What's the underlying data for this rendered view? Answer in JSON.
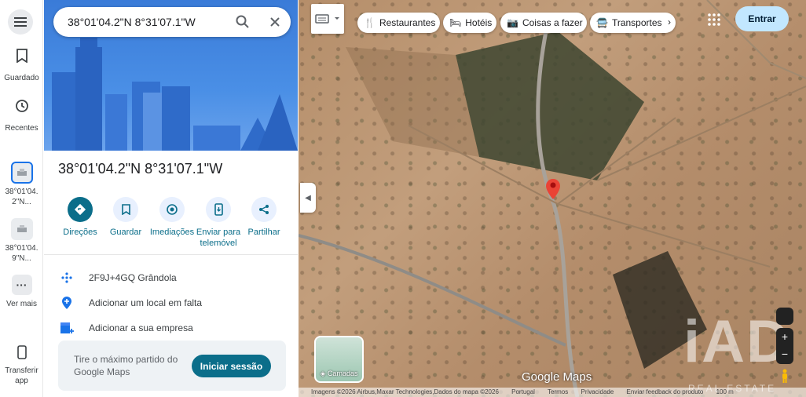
{
  "rail": {
    "saved_label": "Guardado",
    "recent_label": "Recentes",
    "history1_label": "38°01'04. 2\"N...",
    "history2_label": "38°01'04. 9\"N...",
    "more_label": "Ver mais",
    "transfer_label": "Transferir app"
  },
  "search": {
    "value": "38°01'04.2\"N 8°31'07.1\"W"
  },
  "place": {
    "title": "38°01'04.2\"N 8°31'07.1\"W"
  },
  "actions": [
    {
      "label": "Direções"
    },
    {
      "label": "Guardar"
    },
    {
      "label": "Imediações"
    },
    {
      "label": "Enviar para telemóvel"
    },
    {
      "label": "Partilhar"
    }
  ],
  "info": {
    "plus_code": "2F9J+4GQ Grândola",
    "add_place": "Adicionar um local em falta",
    "add_business": "Adicionar a sua empresa"
  },
  "promo": {
    "text": "Tire o máximo partido do Google Maps",
    "button": "Iniciar sessão"
  },
  "chips": [
    {
      "label": "Restaurantes",
      "icon": "fork-knife-icon"
    },
    {
      "label": "Hotéis",
      "icon": "bed-icon"
    },
    {
      "label": "Coisas a fazer",
      "icon": "camera-icon"
    },
    {
      "label": "Transportes",
      "icon": "transit-icon"
    }
  ],
  "map": {
    "signin": "Entrar",
    "layers_label": "Camadas",
    "logo": "Google Maps",
    "footer": {
      "attribution": "Imagens ©2026 Airbus,Maxar Technologies,Dados do mapa ©2026",
      "country": "Portugal",
      "terms": "Termos",
      "privacy": "Privacidade",
      "feedback": "Enviar feedback do produto",
      "scale": "100 m"
    },
    "watermark": "iAD",
    "watermark_sub": "REAL ESTATE"
  },
  "colors": {
    "accent": "#0b6e8a",
    "pin": "#ea4335",
    "signin_bg": "#c2e7ff"
  }
}
